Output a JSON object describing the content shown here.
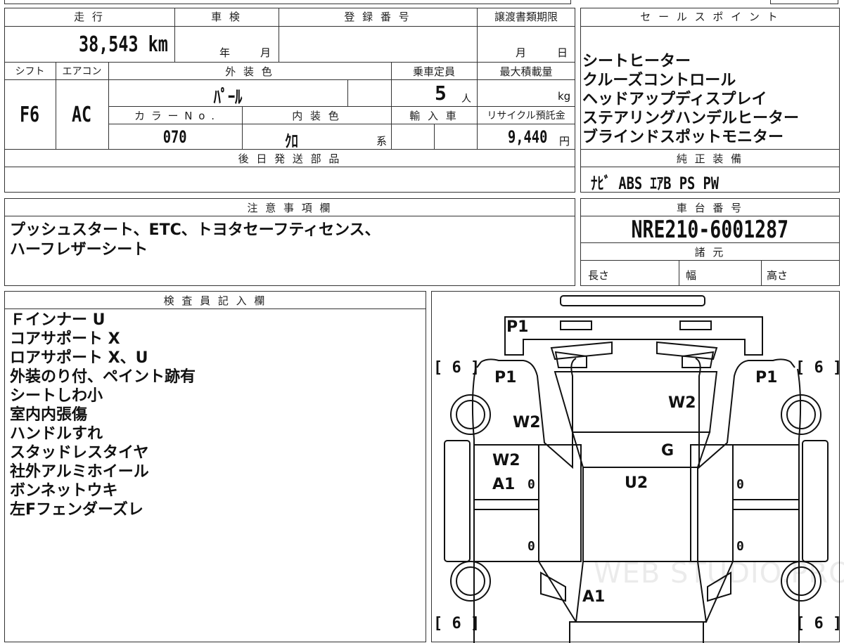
{
  "top": {
    "mileage_header": "走 行",
    "shaken_header": "車 検",
    "registration_header": "登 録 番 号",
    "transfer_deadline_header": "譲渡書類期限",
    "mileage_value": "38,543 km",
    "shaken_year": "年",
    "shaken_month": "月",
    "deadline_month": "月",
    "deadline_day": "日",
    "shift_header": "シフト",
    "aircon_header": "エアコン",
    "exterior_color_header": "外 装 色",
    "capacity_header": "乗車定員",
    "max_load_header": "最大積載量",
    "shift_value": "F6",
    "aircon_value": "AC",
    "exterior_color_value": "ﾊﾟｰﾙ",
    "capacity_value": "5",
    "capacity_unit": "人",
    "max_load_unit": "kg",
    "color_no_header": "カ ラ ー N o .",
    "interior_color_header": "内 装 色",
    "import_header": "輸 入 車",
    "recycle_header": "リサイクル預託金",
    "color_no_value": "070",
    "interior_color_value": "ｸﾛ",
    "interior_color_suffix": "系",
    "recycle_value": "9,440",
    "recycle_unit": "円",
    "later_parts_header": "後 日 発 送 部 品"
  },
  "sales": {
    "header": "セ ー ル ス ポ イ ン ト",
    "points": [
      "シートヒーター",
      "クルーズコントロール",
      "ヘッドアップディスプレイ",
      "ステアリングハンデルヒーター",
      "ブラインドスポットモニター"
    ],
    "equipment_header": "純 正 装 備",
    "equipment_value": "ﾅﾋﾞ ABS ｴｱB PS PW"
  },
  "notes": {
    "header": "注 意 事 項 欄",
    "lines": [
      "プッシュスタート、ETC、トヨタセーフティセンス、",
      "ハーフレザーシート"
    ]
  },
  "chassis": {
    "header": "車 台 番 号",
    "value": "NRE210-6001287",
    "specs_header": "諸 元",
    "length_label": "長さ",
    "width_label": "幅",
    "height_label": "高さ"
  },
  "inspector": {
    "header": "検 査 員 記 入 欄",
    "lines": [
      "Ｆインナー U",
      "コアサポート X",
      "ロアサポート X、U",
      "外装のり付、ペイント跡有",
      "シートしわ小",
      "室内内張傷",
      "ハンドルすれ",
      "スタッドレスタイヤ",
      "社外アルミホイール",
      "ボンネットウキ",
      "左Fフェンダーズレ"
    ]
  },
  "diagram": {
    "front_bumper": "P1",
    "left_fender": "P1",
    "right_fender": "P1",
    "left_apron": "W2",
    "hood": "W2",
    "left_front_door_1": "W2",
    "left_front_door_2": "A1",
    "windshield": "G",
    "roof": "U2",
    "rear": "A1",
    "tire_fl": "[ 6 ]",
    "tire_fr": "[ 6 ]",
    "tire_rl": "[ 6 ]",
    "tire_rr": "[ 6 ]",
    "zero_l1": "0",
    "zero_r1": "0",
    "zero_l2": "0",
    "zero_r2": "0",
    "watermark": "WEB STUDIO.PRO"
  }
}
